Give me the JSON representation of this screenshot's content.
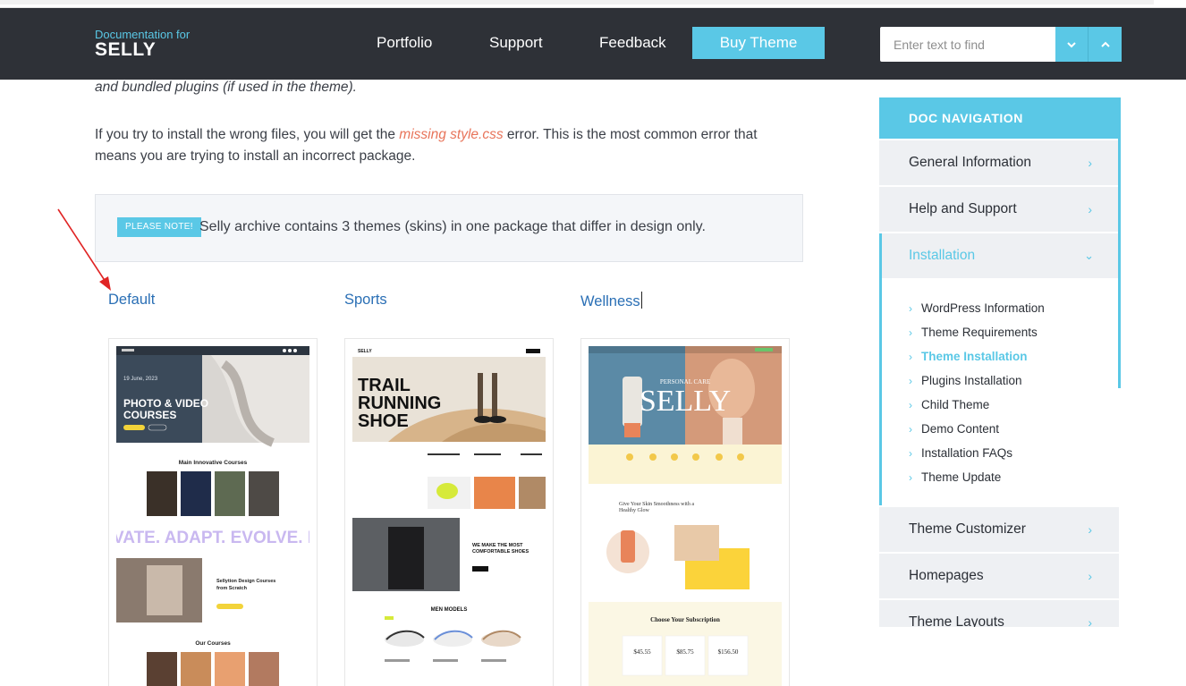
{
  "header": {
    "brand_small": "Documentation for",
    "brand_big": "SELLY",
    "nav": [
      "Portfolio",
      "Support",
      "Feedback"
    ],
    "buy_label": "Buy Theme",
    "search_placeholder": "Enter text to find"
  },
  "content": {
    "fragment": "and bundled plugins (if used in the theme).",
    "para_before": "If you try to install the wrong files, you will get the ",
    "para_link": "missing style.css",
    "para_after": " error. This is the most common error that means you are trying to install an incorrect package.",
    "note_badge": "PLEASE NOTE!",
    "note_text": "Selly archive contains 3 themes (skins) in one package that differ in design only.",
    "themes": [
      "Default",
      "Sports",
      "Wellness"
    ]
  },
  "previews": {
    "default": {
      "date": "19 June, 2023",
      "hero_line1": "PHOTO & VIDEO",
      "hero_line2": "COURSES",
      "section1": "Main Innovative Courses",
      "marquee": "VATE. ADAPT. EVOLVE. II",
      "design_title": "Sellytion Design Courses from Scratch",
      "our_courses": "Our Courses"
    },
    "sports": {
      "hero_line1": "TRAIL",
      "hero_line2": "RUNNING",
      "hero_line3": "SHOE",
      "promo": "WE MAKE THE MOST COMFORTABLE SHOES",
      "men_models": "MEN MODELS"
    },
    "wellness": {
      "hero_small": "PERSONAL CARE",
      "hero_big": "SELLY",
      "glow_title": "Give Your Skin Smoothness with a Healthy Glow",
      "subscription": "Choose Your Subscription",
      "prices": [
        "$45.55",
        "$85.75",
        "$156.50"
      ]
    }
  },
  "sidebar": {
    "heading": "DOC NAVIGATION",
    "items_top": [
      "General Information",
      "Help and Support"
    ],
    "open_item": "Installation",
    "sub_items": [
      "WordPress Information",
      "Theme Requirements",
      "Theme Installation",
      "Plugins Installation",
      "Child Theme",
      "Demo Content",
      "Installation FAQs",
      "Theme Update"
    ],
    "active_sub": "Theme Installation",
    "items_bottom": [
      "Theme Customizer",
      "Homepages",
      "Theme Layouts"
    ]
  },
  "colors": {
    "accent": "#5ac8e6",
    "header_bg": "#2e3137",
    "link_blue": "#2a6fb5",
    "error_red": "#e8745a",
    "annotation_arrow": "#e02424"
  },
  "icons": {
    "search_down": "chevron-down-icon",
    "search_up": "chevron-up-icon",
    "sidebar_chevron": "chevron-right-icon"
  }
}
